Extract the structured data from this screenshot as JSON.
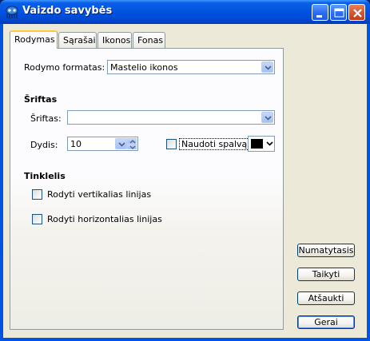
{
  "window": {
    "title": "Vaizdo savybės",
    "controls": [
      "minimize-icon",
      "maximize-icon",
      "close-icon"
    ]
  },
  "tabs": [
    {
      "label": "Rodymas",
      "active": true
    },
    {
      "label": "Sąrašai",
      "active": false
    },
    {
      "label": "Ikonos",
      "active": false
    },
    {
      "label": "Fonas",
      "active": false
    }
  ],
  "display_format": {
    "label": "Rodymo formatas:",
    "value": "Mastelio ikonos"
  },
  "fonts": {
    "section_title": "Šriftas",
    "font_label": "Šriftas:",
    "font_value": "",
    "size_label": "Dydis:",
    "size_value": "10",
    "use_color_label": "Naudoti spalvą",
    "use_color_checked": false,
    "color_value": "#000000"
  },
  "grid": {
    "section_title": "Tinklelis",
    "vertical_label": "Rodyti vertikalias linijas",
    "vertical_checked": false,
    "horizontal_label": "Rodyti horizontalias linijas",
    "horizontal_checked": false
  },
  "buttons": {
    "defaults": "Numatytasis",
    "apply": "Taikyti",
    "cancel": "Atšaukti",
    "ok": "Gerai"
  },
  "colors": {
    "titlebar": "#0053e1",
    "tab_highlight": "#ffc83c",
    "dialog_bg": "#ece9d8"
  }
}
